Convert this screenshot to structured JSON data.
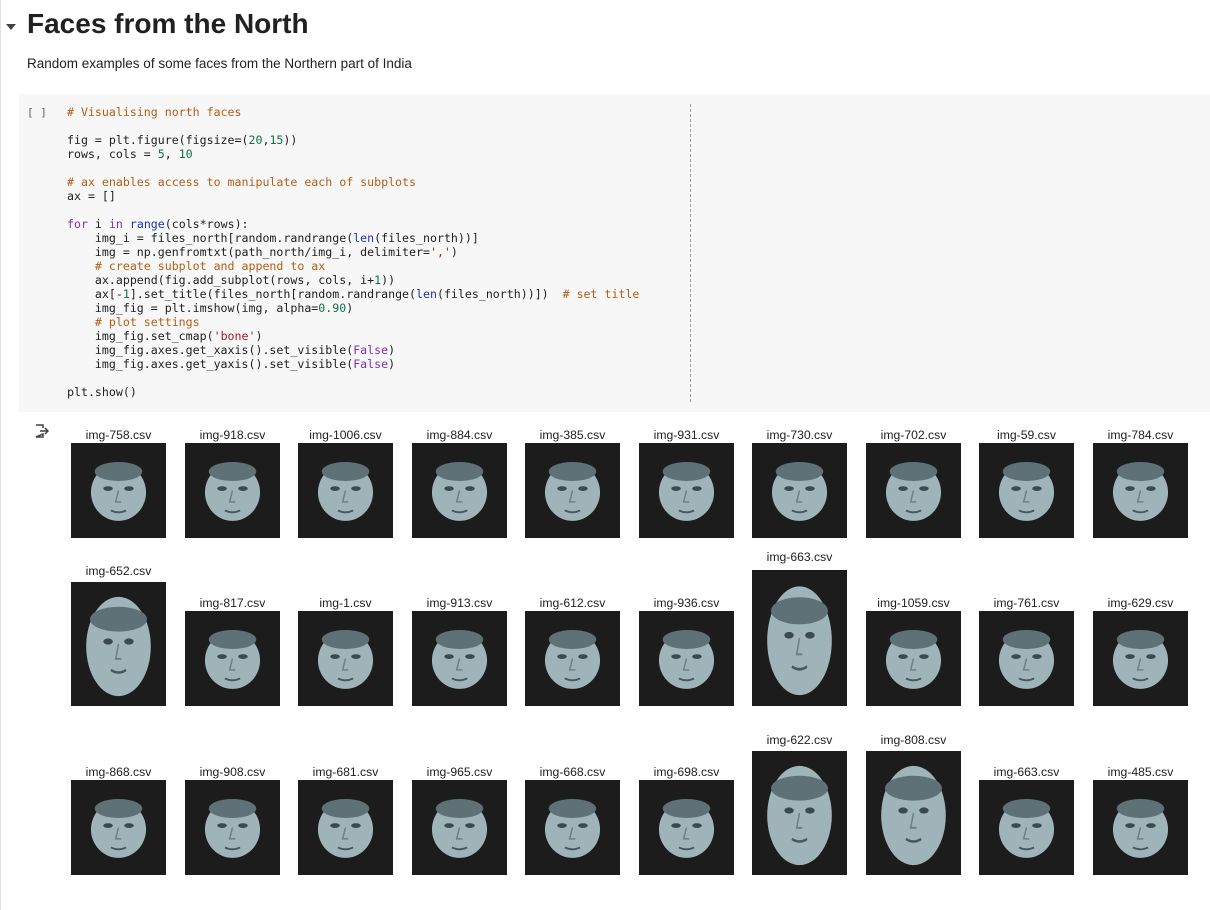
{
  "section": {
    "title": "Faces from the North",
    "description": "Random examples of some faces from the Northern part of India"
  },
  "cell": {
    "run_indicator": "[ ]",
    "code": [
      [
        [
          "cm",
          "# Visualising north faces"
        ]
      ],
      [],
      [
        [
          "",
          "fig = plt.figure(figsize=("
        ],
        [
          "num",
          "20"
        ],
        [
          "",
          ","
        ],
        [
          "num",
          "15"
        ],
        [
          "",
          "))"
        ]
      ],
      [
        [
          "",
          "rows, cols = "
        ],
        [
          "num",
          "5"
        ],
        [
          "",
          ", "
        ],
        [
          "num",
          "10"
        ]
      ],
      [],
      [
        [
          "cm",
          "# ax enables access to manipulate each of subplots"
        ]
      ],
      [
        [
          "",
          "ax = []"
        ]
      ],
      [],
      [
        [
          "kw",
          "for"
        ],
        [
          "",
          " i "
        ],
        [
          "kw",
          "in"
        ],
        [
          "",
          " "
        ],
        [
          "bi",
          "range"
        ],
        [
          "",
          "(cols*rows):"
        ]
      ],
      [
        [
          "",
          "    img_i = files_north[random.randrange("
        ],
        [
          "bi",
          "len"
        ],
        [
          "",
          "(files_north))]"
        ]
      ],
      [
        [
          "",
          "    img = np.genfromtxt(path_north/img_i, delimiter="
        ],
        [
          "str",
          "','"
        ],
        [
          "",
          ")"
        ]
      ],
      [
        [
          "cm",
          "    # create subplot and append to ax"
        ]
      ],
      [
        [
          "",
          "    ax.append(fig.add_subplot(rows, cols, i+"
        ],
        [
          "num",
          "1"
        ],
        [
          "",
          "))"
        ]
      ],
      [
        [
          "",
          "    ax[-"
        ],
        [
          "num",
          "1"
        ],
        [
          "",
          "].set_title(files_north[random.randrange("
        ],
        [
          "bi",
          "len"
        ],
        [
          "",
          "(files_north))])  "
        ],
        [
          "cm",
          "# set title"
        ]
      ],
      [
        [
          "",
          "    img_fig = plt.imshow(img, alpha="
        ],
        [
          "num",
          "0.90"
        ],
        [
          "",
          ")"
        ]
      ],
      [
        [
          "cm",
          "    # plot settings"
        ]
      ],
      [
        [
          "",
          "    img_fig.set_cmap("
        ],
        [
          "str",
          "'bone'"
        ],
        [
          "",
          ")"
        ]
      ],
      [
        [
          "",
          "    img_fig.axes.get_xaxis().set_visible("
        ],
        [
          "kw",
          "False"
        ],
        [
          "",
          ")"
        ]
      ],
      [
        [
          "",
          "    img_fig.axes.get_yaxis().set_visible("
        ],
        [
          "kw",
          "False"
        ],
        [
          "",
          ")"
        ]
      ],
      [],
      [
        [
          "",
          "plt.show()"
        ]
      ]
    ]
  },
  "output": {
    "rows": [
      {
        "items": [
          {
            "title": "img-758.csv",
            "size": "sm"
          },
          {
            "title": "img-918.csv",
            "size": "sm"
          },
          {
            "title": "img-1006.csv",
            "size": "sm"
          },
          {
            "title": "img-884.csv",
            "size": "sm"
          },
          {
            "title": "img-385.csv",
            "size": "sm"
          },
          {
            "title": "img-931.csv",
            "size": "sm"
          },
          {
            "title": "img-730.csv",
            "size": "sm"
          },
          {
            "title": "img-702.csv",
            "size": "sm"
          },
          {
            "title": "img-59.csv",
            "size": "sm"
          },
          {
            "title": "img-784.csv",
            "size": "sm"
          }
        ]
      },
      {
        "items": [
          {
            "title": "img-652.csv",
            "size": "lg"
          },
          {
            "title": "img-817.csv",
            "size": "sm"
          },
          {
            "title": "img-1.csv",
            "size": "sm"
          },
          {
            "title": "img-913.csv",
            "size": "sm"
          },
          {
            "title": "img-612.csv",
            "size": "sm"
          },
          {
            "title": "img-936.csv",
            "size": "sm"
          },
          {
            "title": "img-663.csv",
            "size": "tall"
          },
          {
            "title": "img-1059.csv",
            "size": "sm"
          },
          {
            "title": "img-761.csv",
            "size": "sm"
          },
          {
            "title": "img-629.csv",
            "size": "sm"
          }
        ]
      },
      {
        "items": [
          {
            "title": "img-868.csv",
            "size": "sm"
          },
          {
            "title": "img-908.csv",
            "size": "sm"
          },
          {
            "title": "img-681.csv",
            "size": "sm"
          },
          {
            "title": "img-965.csv",
            "size": "sm"
          },
          {
            "title": "img-668.csv",
            "size": "sm"
          },
          {
            "title": "img-698.csv",
            "size": "sm"
          },
          {
            "title": "img-622.csv",
            "size": "lg"
          },
          {
            "title": "img-808.csv",
            "size": "lg"
          },
          {
            "title": "img-663.csv",
            "size": "sm"
          },
          {
            "title": "img-485.csv",
            "size": "sm"
          }
        ]
      }
    ]
  },
  "colors": {
    "figure_background": "#1c1c1c",
    "face_tone": "#9eb4b8",
    "code_background": "#f7f7f7"
  }
}
